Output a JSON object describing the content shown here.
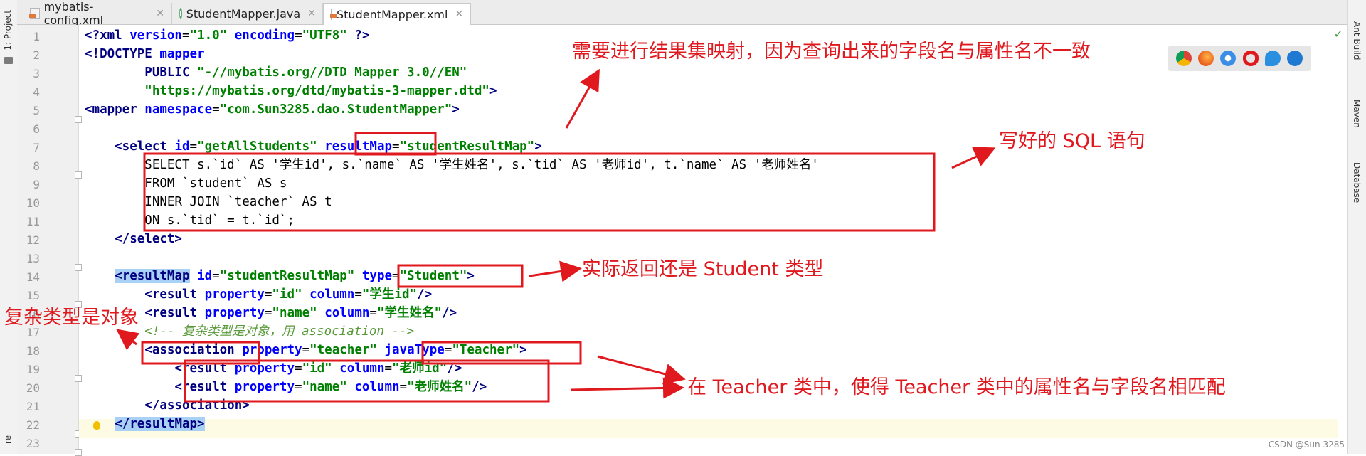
{
  "left_strip": {
    "project_label": "1: Project",
    "bottom_label": "re"
  },
  "tabs": [
    {
      "label": "mybatis-config.xml",
      "icon": "xml-file-icon",
      "active": false
    },
    {
      "label": "StudentMapper.java",
      "icon": "java-interface-icon",
      "active": false
    },
    {
      "label": "StudentMapper.xml",
      "icon": "xml-file-icon",
      "active": true
    }
  ],
  "right_strip": {
    "ant": "Ant Build",
    "maven": "Maven",
    "database": "Database"
  },
  "line_numbers": [
    "1",
    "2",
    "3",
    "4",
    "5",
    "6",
    "7",
    "8",
    "9",
    "10",
    "11",
    "12",
    "13",
    "14",
    "15",
    "16",
    "17",
    "18",
    "19",
    "20",
    "21",
    "22",
    "23"
  ],
  "code": {
    "l1": {
      "a": "<?xml ",
      "b": "version",
      "c": "=",
      "d": "\"1.0\"",
      "e": " ",
      "f": "encoding",
      "g": "=",
      "h": "\"UTF8\"",
      "i": " ?>"
    },
    "l2": {
      "a": "<!DOCTYPE ",
      "b": "mapper"
    },
    "l3": {
      "a": "        PUBLIC ",
      "b": "\"-//mybatis.org//DTD Mapper 3.0//EN\""
    },
    "l4": {
      "a": "        ",
      "b": "\"https://mybatis.org/dtd/mybatis-3-mapper.dtd\"",
      "c": ">"
    },
    "l5": {
      "a": "<mapper ",
      "b": "namespace",
      "c": "=",
      "d": "\"com.Sun3285.dao.StudentMapper\"",
      "e": ">"
    },
    "l7": {
      "a": "    <select ",
      "b": "id",
      "c": "=",
      "d": "\"getAllStudents\"",
      "e": " ",
      "f": "resultMap",
      "g": "=",
      "h": "\"studentResultMap\"",
      "i": ">"
    },
    "l8": "        SELECT s.`id` AS '学生id', s.`name` AS '学生姓名', s.`tid` AS '老师id', t.`name` AS '老师姓名'",
    "l9": "        FROM `student` AS s",
    "l10": "        INNER JOIN `teacher` AS t",
    "l11": "        ON s.`tid` = t.`id`;",
    "l12": "    </select>",
    "l14": {
      "a": "    ",
      "b": "<resultMap",
      "c": " ",
      "d": "id",
      "e": "=",
      "f": "\"studentResultMap\"",
      "g": " ",
      "h": "type",
      "i": "=",
      "j": "\"Student\"",
      "k": ">"
    },
    "l15": {
      "a": "        <result ",
      "b": "property",
      "c": "=",
      "d": "\"id\"",
      "e": " ",
      "f": "column",
      "g": "=",
      "h": "\"学生id\"",
      "i": "/>"
    },
    "l16": {
      "a": "        <result ",
      "b": "property",
      "c": "=",
      "d": "\"name\"",
      "e": " ",
      "f": "column",
      "g": "=",
      "h": "\"学生姓名\"",
      "i": "/>"
    },
    "l17": "        <!-- 复杂类型是对象，用 association -->",
    "l18": {
      "a": "        <association",
      "b": " ",
      "c": "property",
      "d": "=",
      "e": "\"teacher\"",
      "f": " ",
      "g": "javaType",
      "h": "=",
      "i": "\"Teacher\"",
      "j": ">"
    },
    "l19": {
      "a": "            <result ",
      "b": "property",
      "c": "=",
      "d": "\"id\"",
      "e": " ",
      "f": "column",
      "g": "=",
      "h": "\"老师id\"",
      "i": "/>"
    },
    "l20": {
      "a": "            <result ",
      "b": "property",
      "c": "=",
      "d": "\"name\"",
      "e": " ",
      "f": "column",
      "g": "=",
      "h": "\"老师姓名\"",
      "i": "/>"
    },
    "l21": "        </association>",
    "l22": {
      "a": "    ",
      "b": "</resultMap>"
    }
  },
  "annotations": {
    "top": "需要进行结果集映射，因为查询出来的字段名与属性名不一致",
    "sql": "写好的 SQL 语句",
    "type": "实际返回还是 Student 类型",
    "complex": "复杂类型是对象",
    "teacher": "在 Teacher 类中，使得 Teacher 类中的属性名与字段名相匹配"
  },
  "browsers": [
    "chrome-icon",
    "firefox-icon",
    "safari-icon",
    "opera-icon",
    "ie-icon",
    "edge-icon"
  ],
  "watermark": "CSDN @Sun 3285",
  "colors": {
    "annotation": "#e0191f",
    "tag": "#000080",
    "attr": "#0000ff",
    "value": "#008000",
    "comment": "#5a9a3a"
  }
}
